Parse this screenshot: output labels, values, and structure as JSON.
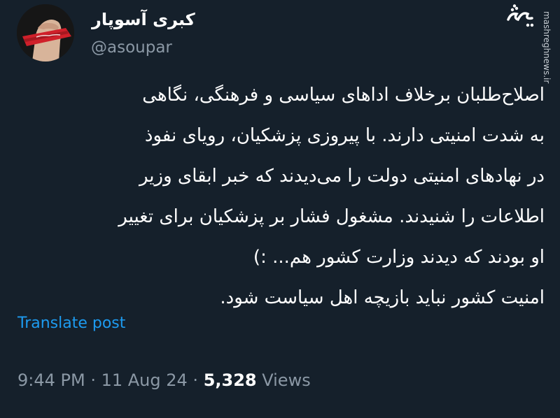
{
  "author": {
    "display_name": "کبری آسوپار",
    "handle": "@asoupar"
  },
  "watermark": {
    "logo_text": "مشرق",
    "site": "mashreghnews.ir"
  },
  "tweet": {
    "lines": [
      "اصلاح‌طلبان برخلاف اداهای سیاسی و فرهنگی، نگاهی",
      "به شدت امنیتی دارند. با پیروزی پزشکیان، رویای نفوذ",
      "در نهادهای امنیتی دولت را می‌دیدند که خبر ابقای وزیر",
      "اطلاعات را شنیدند. مشغول فشار بر پزشکیان برای تغییر",
      "او بودند که دیدند وزارت کشور هم... :)",
      "امنیت کشور نباید بازیچه اهل سیاست شود."
    ],
    "translate_label": "Translate post"
  },
  "meta": {
    "time": "9:44 PM",
    "separator": " · ",
    "date": "11 Aug 24",
    "views_count": "5,328",
    "views_label": "Views"
  },
  "colors": {
    "background": "#15202b",
    "text_primary": "#ffffff",
    "text_secondary": "#8b98a5",
    "link": "#1d9bf0"
  }
}
